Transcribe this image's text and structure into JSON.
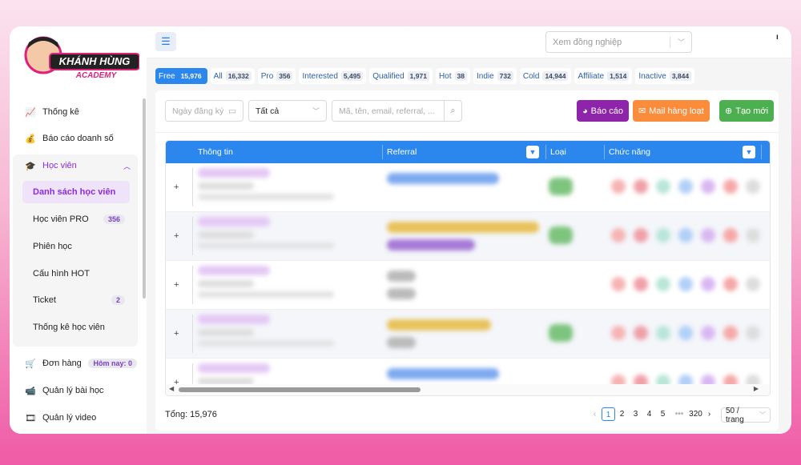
{
  "brand": {
    "logo_line1": "KHÁNH HÙNG",
    "logo_line2": "ACADEMY"
  },
  "sidebar": {
    "items": [
      {
        "label": "Thống kê",
        "icon": "chart-line-icon"
      },
      {
        "label": "Báo cáo doanh số",
        "icon": "money-report-icon"
      },
      {
        "label": "Học viên",
        "icon": "graduate-icon"
      }
    ],
    "sub_items": [
      {
        "label": "Danh sách học viên",
        "badge": null
      },
      {
        "label": "Học viên PRO",
        "badge": "356"
      },
      {
        "label": "Phiên học",
        "badge": null
      },
      {
        "label": "Cấu hình HOT",
        "badge": null
      },
      {
        "label": "Ticket",
        "badge": "2"
      },
      {
        "label": "Thống kê học viên",
        "badge": null
      }
    ],
    "bottom_items": [
      {
        "label": "Đơn hàng",
        "badge": "Hôm nay: 0",
        "icon": "cart-icon"
      },
      {
        "label": "Quản lý bài học",
        "icon": "video-camera-icon"
      },
      {
        "label": "Quản lý video",
        "icon": "video-library-icon"
      }
    ]
  },
  "header": {
    "colleague_placeholder": "Xem đồng nghiệp",
    "mark": "ı"
  },
  "tabs": [
    {
      "label": "Free",
      "count": "15,976",
      "active": true
    },
    {
      "label": "All",
      "count": "16,332"
    },
    {
      "label": "Pro",
      "count": "356"
    },
    {
      "label": "Interested",
      "count": "5,495"
    },
    {
      "label": "Qualified",
      "count": "1,971"
    },
    {
      "label": "Hot",
      "count": "38"
    },
    {
      "label": "Indie",
      "count": "732"
    },
    {
      "label": "Cold",
      "count": "14,944"
    },
    {
      "label": "Affiliate",
      "count": "1,514"
    },
    {
      "label": "Inactive",
      "count": "3,844"
    }
  ],
  "filters": {
    "date_placeholder": "Ngày đăng ký",
    "type_value": "Tất cả",
    "search_placeholder": "Mã, tên, email, referral, ..."
  },
  "actions": {
    "report": "Báo cáo",
    "mail": "Mail hàng loạt",
    "create": "Tạo mới",
    "colors": {
      "report": "#8e24aa",
      "mail": "#fb8c3c",
      "create": "#4caf50"
    }
  },
  "table": {
    "columns": [
      "Thông tin",
      "Referral",
      "Loại",
      "Chức năng"
    ],
    "header_color": "#2b86ee"
  },
  "footer": {
    "total": "Tổng: 15,976",
    "pages": [
      "1",
      "2",
      "3",
      "4",
      "5",
      "•••",
      "320"
    ],
    "current_page": "1",
    "page_size": "50 / trang"
  }
}
